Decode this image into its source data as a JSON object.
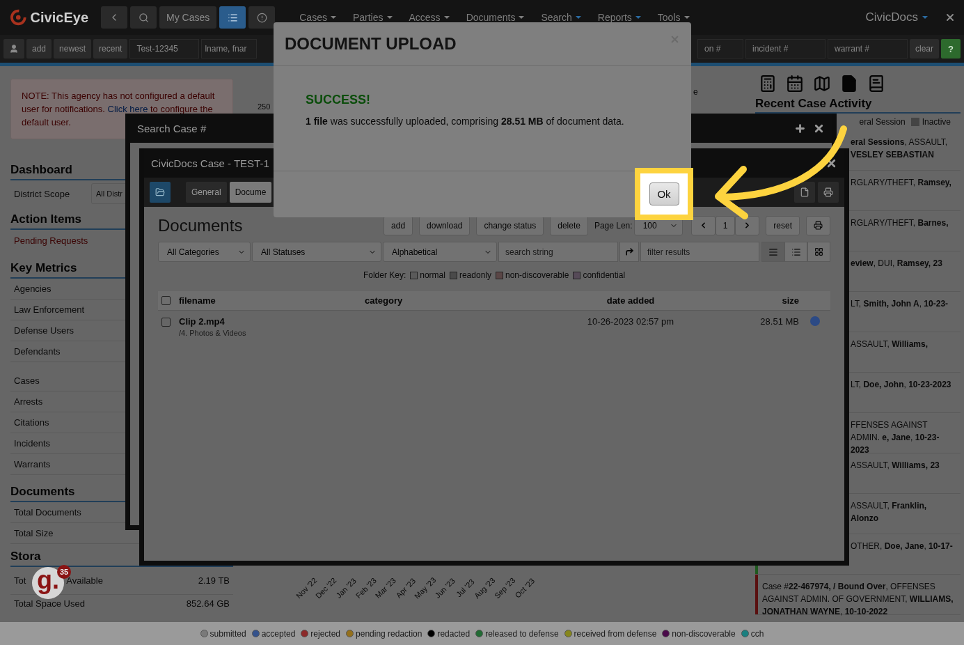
{
  "top_nav": {
    "logo": "CivicEye",
    "buttons": [
      {
        "kind": "back",
        "selected": false
      },
      {
        "kind": "search",
        "selected": false
      },
      {
        "kind": "text",
        "label": "My Cases",
        "selected": false
      },
      {
        "kind": "list",
        "selected": true
      },
      {
        "kind": "info",
        "selected": false
      }
    ],
    "menu": [
      {
        "label": "Cases",
        "highlighted": false
      },
      {
        "label": "Parties",
        "highlighted": false
      },
      {
        "label": "Access",
        "highlighted": false
      },
      {
        "label": "Documents",
        "highlighted": false
      },
      {
        "label": "Search",
        "highlighted": true
      },
      {
        "label": "Reports",
        "highlighted": true
      },
      {
        "label": "Tools",
        "highlighted": false
      }
    ],
    "app_switch": {
      "label": "CivicDocs",
      "highlighted": true
    }
  },
  "search_bar": {
    "buttons": [
      "add",
      "newest",
      "recent"
    ],
    "case_field": {
      "value": "Test-12345"
    },
    "name_field": {
      "placeholder": "lname, fnar"
    },
    "right_fields": [
      {
        "placeholder": "on #"
      },
      {
        "placeholder": "incident #"
      },
      {
        "placeholder": "warrant #"
      }
    ],
    "clear": "clear",
    "help": "?"
  },
  "left": {
    "note": {
      "before": "NOTE: This agency has not configured a default user for notifications.",
      "link": "Click here",
      "after": "to configure the default user."
    },
    "dashboard": {
      "title": "Dashboard",
      "scope_label": "District Scope",
      "scope_select": "All Distr"
    },
    "action_items": {
      "title": "Action Items",
      "items": [
        "Pending Requests"
      ]
    },
    "key_metrics": {
      "title": "Key Metrics",
      "groups": [
        [
          "Agencies",
          "Law Enforcement",
          "Defense Users",
          "Defendants"
        ],
        [
          "Cases",
          "Arrests",
          "Citations",
          "Incidents",
          "Warrants"
        ]
      ]
    },
    "documents": {
      "title": "Documents",
      "items": [
        "Total Documents",
        "Total Size"
      ]
    },
    "storage": {
      "title": "Stora",
      "rows": [
        {
          "label": "Tot",
          "label_end": "Available",
          "value": "2.19 TB"
        },
        {
          "label": "Total Space Used",
          "value": "852.64 GB"
        }
      ]
    }
  },
  "middle": {
    "axis_tick": "250",
    "fragment": "e",
    "months": [
      "Nov '22",
      "Dec '22",
      "Jan '23",
      "Feb '23",
      "Mar '23",
      "Apr '23",
      "May '23",
      "Jun '23",
      "Jul '23",
      "Aug '23",
      "Sep '23",
      "Oct '23"
    ]
  },
  "right": {
    "title": "Recent Case Activity",
    "legend": [
      {
        "label": "eral Session",
        "swatch": false
      },
      {
        "label": "Inactive",
        "swatch": true
      }
    ],
    "items": [
      {
        "kind": "fragment",
        "text": "**eral Sessions**, ASSAULT, **VESLEY SEBASTIAN**"
      },
      {
        "kind": "fragment",
        "text": "RGLARY/THEFT, **Ramsey,**"
      },
      {
        "kind": "fragment",
        "text": "RGLARY/THEFT, **Barnes,**"
      },
      {
        "kind": "fragment",
        "text": "**eview**, DUI, **Ramsey, 23**"
      },
      {
        "kind": "fragment",
        "text": "LT, **Smith, John A**, **10-23-**"
      },
      {
        "kind": "fragment",
        "text": "ASSAULT, **Williams,**"
      },
      {
        "kind": "fragment",
        "text": "LT, **Doe, John**, **10-23-2023**"
      },
      {
        "kind": "fragment",
        "text": "FFENSES AGAINST ADMIN. **e, Jane**, **10-23-2023**"
      },
      {
        "kind": "fragment",
        "text": "ASSAULT, **Williams, 23**"
      },
      {
        "kind": "fragment",
        "text": "ASSAULT, **Franklin, Alonzo**"
      },
      {
        "kind": "fragment",
        "text": "OTHER, **Doe, Jane**, **10-17-**",
        "color": "#1f5a1f"
      },
      {
        "kind": "full",
        "text": "Case #**22-467974, / Bound Over**, OFFENSES AGAINST ADMIN. OF GOVERNMENT, **WILLIAMS, JONATHAN WAYNE**, **10-10-2022**",
        "color": "#5a1010"
      }
    ]
  },
  "search_window": {
    "title": "Search Case #"
  },
  "case_window": {
    "title": "CivicDocs Case - TEST-1",
    "tabs": [
      {
        "label": "General",
        "selected": false
      },
      {
        "label": "Docume",
        "selected": true
      }
    ],
    "heading": "Documents",
    "actions": [
      "add",
      "download",
      "change status",
      "delete"
    ],
    "page_len_label": "Page Len:",
    "page_len": "100",
    "page": "1",
    "reset": "reset",
    "filters": {
      "category": "All Categories",
      "status": "All Statuses",
      "sort": "Alphabetical",
      "search_placeholder": "search string",
      "filter_placeholder": "filter results"
    },
    "views": [
      {
        "kind": "detail",
        "selected": true
      },
      {
        "kind": "list",
        "selected": false
      },
      {
        "kind": "grid",
        "selected": false
      }
    ],
    "folder_key": {
      "label": "Folder Key:",
      "items": [
        {
          "label": "normal",
          "color": "#5a5a5a"
        },
        {
          "label": "readonly",
          "color": "#4a4a4a"
        },
        {
          "label": "non-discoverable",
          "color": "#5a4646"
        },
        {
          "label": "confidential",
          "color": "#564a58"
        }
      ]
    },
    "columns": [
      "filename",
      "category",
      "date added",
      "size"
    ],
    "all_checked": false,
    "rows": [
      {
        "filename": "Clip 2.mp4",
        "path": "/4. Photos & Videos",
        "category": "",
        "date": "10-26-2023 02:57 pm",
        "size": "28.51 MB",
        "checked": false,
        "color": "#2c4a85"
      }
    ]
  },
  "modal": {
    "title": "DOCUMENT UPLOAD",
    "status": "SUCCESS!",
    "message": "**1 file** was successfully uploaded, comprising **28.51 MB** of document data.",
    "ok": "Ok"
  },
  "badge": {
    "logo": "g.",
    "count": "35"
  },
  "status_legend": [
    {
      "label": "submitted",
      "color": "#7a7a7a"
    },
    {
      "label": "accepted",
      "color": "#34528c"
    },
    {
      "label": "rejected",
      "color": "#8c2a2a"
    },
    {
      "label": "pending redaction",
      "color": "#94701c"
    },
    {
      "label": "redacted",
      "color": "#000000"
    },
    {
      "label": "released to defense",
      "color": "#226b34"
    },
    {
      "label": "received from defense",
      "color": "#86861c"
    },
    {
      "label": "non-discoverable",
      "color": "#4a0a4a"
    },
    {
      "label": "cch",
      "color": "#1a8080"
    }
  ]
}
